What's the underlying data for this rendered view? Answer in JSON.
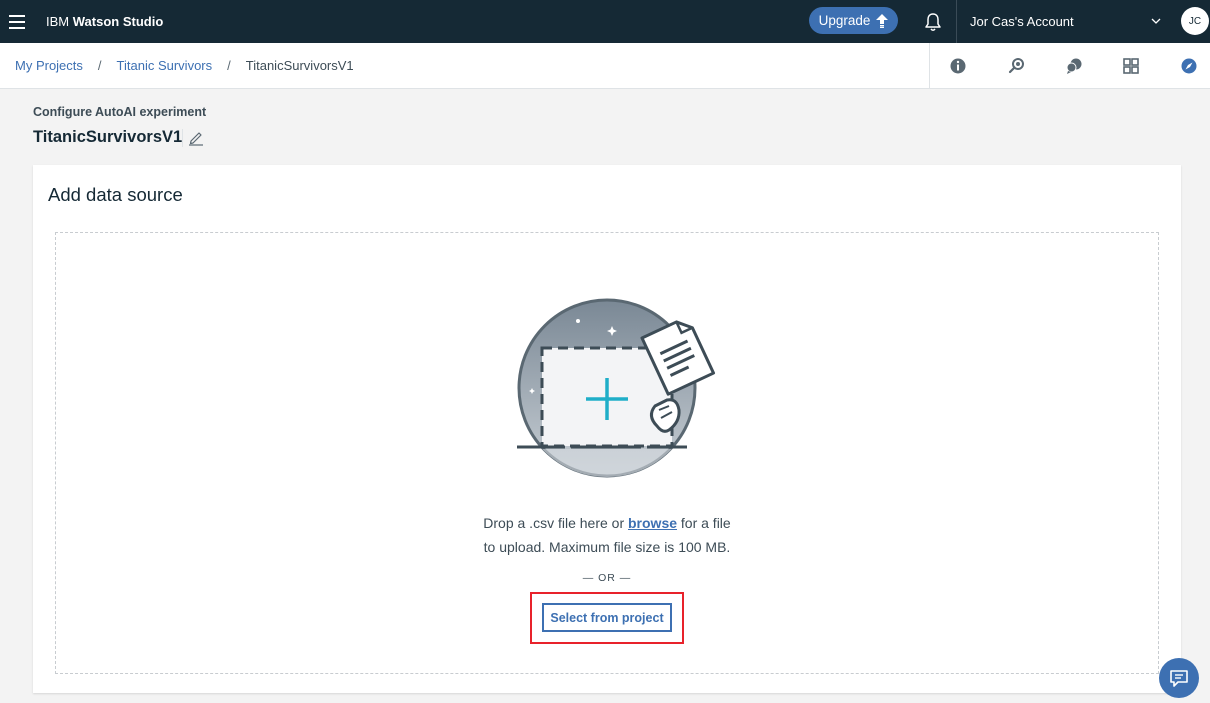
{
  "topbar": {
    "brand_prefix": "IBM",
    "brand_name": "Watson Studio",
    "upgrade_label": "Upgrade",
    "account_name": "Jor Cas's Account",
    "avatar_initials": "JC"
  },
  "breadcrumb": {
    "items": [
      {
        "label": "My Projects"
      },
      {
        "label": "Titanic Survivors"
      }
    ],
    "separator": "/",
    "current": "TitanicSurvivorsV1"
  },
  "header": {
    "subtitle": "Configure AutoAI experiment",
    "title": "TitanicSurvivorsV1"
  },
  "card": {
    "title": "Add data source",
    "drop_text_before": "Drop a .csv file here or",
    "browse_link": "browse",
    "drop_text_after": "for a file",
    "drop_text_line2": "to upload. Maximum file size is 100 MB.",
    "or_text": "— OR —",
    "select_button": "Select from project"
  },
  "colors": {
    "topbar_bg": "#152935",
    "accent": "#3d70b2",
    "highlight": "#e8222b"
  }
}
